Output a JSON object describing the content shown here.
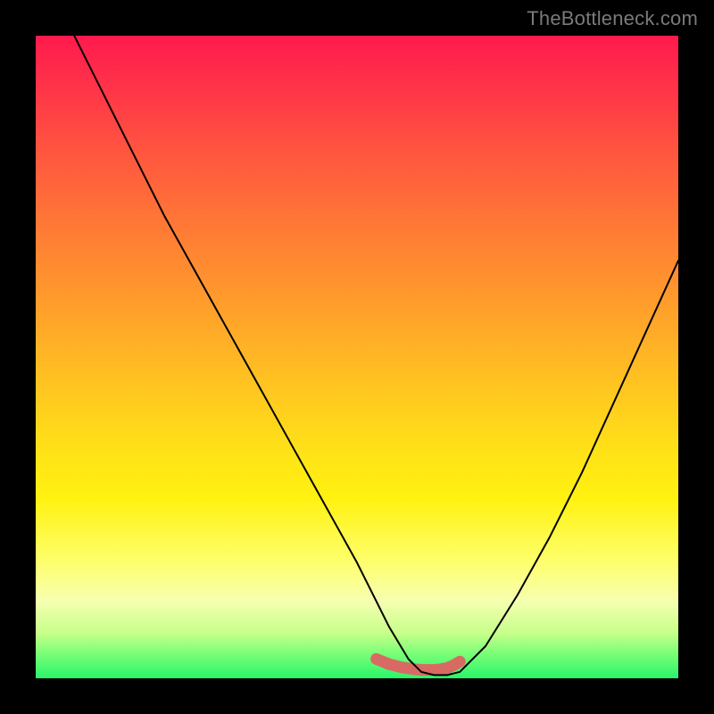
{
  "watermark": "TheBottleneck.com",
  "chart_data": {
    "type": "line",
    "title": "",
    "xlabel": "",
    "ylabel": "",
    "xlim": [
      0,
      100
    ],
    "ylim": [
      0,
      100
    ],
    "grid": false,
    "series": [
      {
        "name": "bottleneck-curve",
        "x": [
          6,
          10,
          15,
          20,
          25,
          30,
          35,
          40,
          45,
          50,
          53,
          55,
          58,
          60,
          62,
          64,
          66,
          70,
          75,
          80,
          85,
          90,
          95,
          100
        ],
        "values": [
          100,
          92,
          82,
          72,
          63,
          54,
          45,
          36,
          27,
          18,
          12,
          8,
          3,
          1,
          0.5,
          0.5,
          1,
          5,
          13,
          22,
          32,
          43,
          54,
          65
        ]
      }
    ],
    "highlight_region": {
      "name": "sweet-spot",
      "x": [
        53,
        55,
        57,
        59,
        60,
        61,
        62,
        63,
        64,
        65,
        66
      ],
      "values": [
        3.0,
        2.2,
        1.7,
        1.4,
        1.3,
        1.3,
        1.3,
        1.4,
        1.6,
        2.0,
        2.6
      ],
      "color": "#d86a63",
      "stroke_width": 13
    },
    "curve_color": "#000000",
    "curve_width": 2
  }
}
